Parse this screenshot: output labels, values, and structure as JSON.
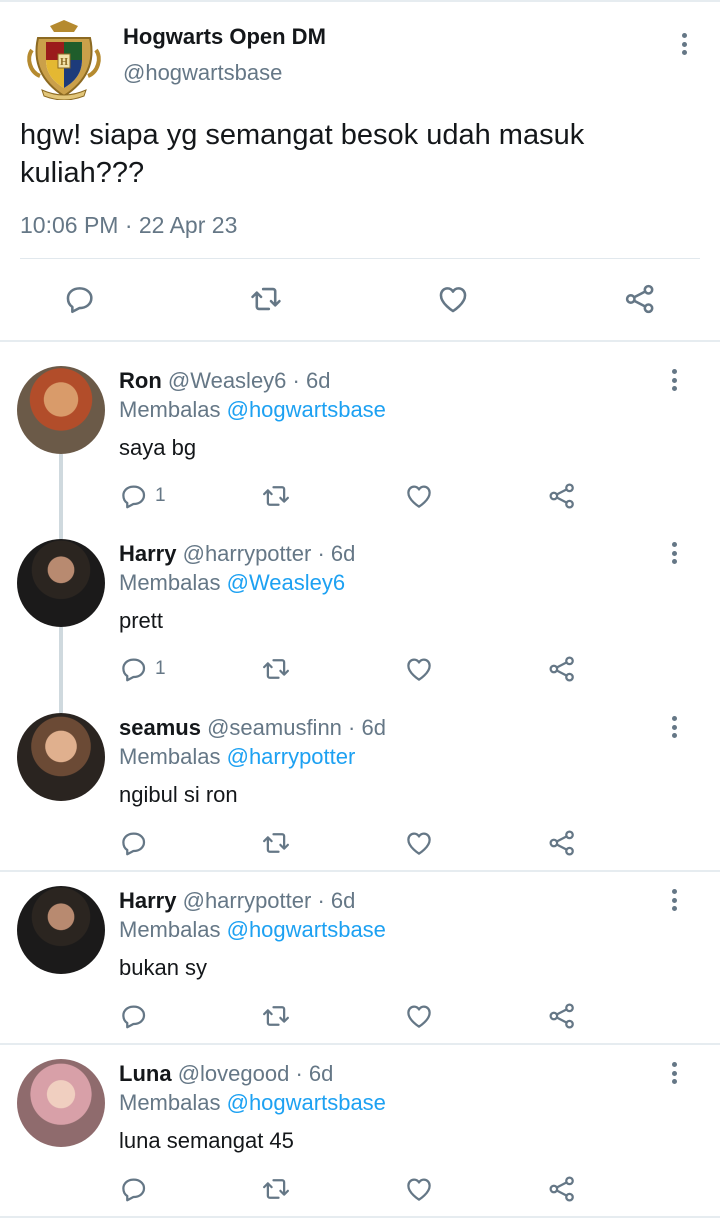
{
  "tweet": {
    "author_name": "Hogwarts Open DM",
    "author_handle": "@hogwartsbase",
    "text": "hgw! siapa yg semangat besok udah masuk kuliah???",
    "timestamp": "10:06 PM · 22 Apr 23",
    "avatar_icon": "hogwarts-crest-icon"
  },
  "replying_label": "Membalas",
  "replies": [
    {
      "name": "Ron",
      "handle": "@Weasley6",
      "age": "· 6d",
      "replying_to": "@hogwartsbase",
      "text": "saya bg",
      "reply_count": "1",
      "avatar_colors": [
        "#c46a3a",
        "#8e5a3c"
      ]
    },
    {
      "name": "Harry",
      "handle": "@harrypotter",
      "age": "· 6d",
      "replying_to": "@Weasley6",
      "text": "prett",
      "reply_count": "1",
      "avatar_colors": [
        "#3a3530",
        "#1e1c1b"
      ]
    },
    {
      "name": "seamus",
      "handle": "@seamusfinn",
      "age": "· 6d",
      "replying_to": "@harrypotter",
      "text": "ngibul si ron",
      "reply_count": "",
      "avatar_colors": [
        "#6b4a35",
        "#2a2420"
      ]
    },
    {
      "name": "Harry",
      "handle": "@harrypotter",
      "age": "· 6d",
      "replying_to": "@hogwartsbase",
      "text": "bukan sy",
      "reply_count": "",
      "avatar_colors": [
        "#3a3530",
        "#1e1c1b"
      ]
    },
    {
      "name": "Luna",
      "handle": "@lovegood",
      "age": "· 6d",
      "replying_to": "@hogwartsbase",
      "text": "luna semangat 45",
      "reply_count": "",
      "avatar_colors": [
        "#d7a3a8",
        "#8f6b6d"
      ]
    }
  ],
  "colors": {
    "accent": "#1da1f2",
    "secondary_text": "#657786",
    "primary_text": "#14171a",
    "divider": "#e6ecf0"
  }
}
